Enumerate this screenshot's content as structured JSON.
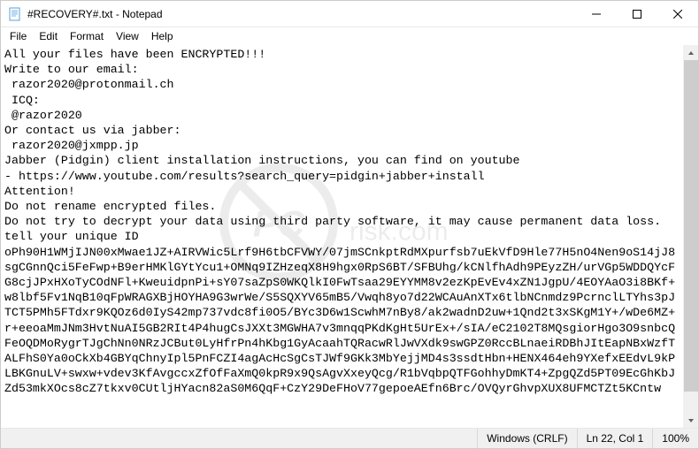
{
  "window": {
    "title": "#RECOVERY#.txt - Notepad"
  },
  "menu": {
    "file": "File",
    "edit": "Edit",
    "format": "Format",
    "view": "View",
    "help": "Help"
  },
  "content": "All your files have been ENCRYPTED!!!\nWrite to our email:\n razor2020@protonmail.ch\n ICQ:\n @razor2020\nOr contact us via jabber:\n razor2020@jxmpp.jp\nJabber (Pidgin) client installation instructions, you can find on youtube\n- https://www.youtube.com/results?search_query=pidgin+jabber+install\nAttention!\nDo not rename encrypted files.\nDo not try to decrypt your data using third party software, it may cause permanent data loss.\ntell your unique ID\noPh90H1WMjIJN00xMwae1JZ+AIRVWic5Lrf9H6tbCFVWY/07jmSCnkptRdMXpurfsb7uEkVfD9Hle77H5nO4Nen9oS14jJ8sgCGnnQci5FeFwp+B9erHMKlGYtYcu1+OMNq9IZHzeqX8H9hgx0RpS6BT/SFBUhg/kCNlfhAdh9PEyzZH/urVGp5WDDQYcFG8cjJPxHXoTyCOdNFl+KweuidpnPi+sY07saZpS0WKQlkI0FwTsaa29EYYMM8v2ezKpEvEv4xZN1JgpU/4EOYAaO3i8BKf+w8lbf5Fv1NqB10qFpWRAGXBjHOYHA9G3wrWe/S5SQXYV65mB5/Vwqh8yo7d22WCAuAnXTx6tlbNCnmdz9PcrnclLTYhs3pJTCT5PMh5FTdxr9KQOz6d0IyS42mp737vdc8fi0O5/BYc3D6w1ScwhM7nBy8/ak2wadnD2uw+1Qnd2t3xSKgM1Y+/wDe6MZ+r+eeoaMmJNm3HvtNuAI5GB2RIt4P4hugCsJXXt3MGWHA7v3mnqqPKdKgHt5UrEx+/sIA/eC2102T8MQsgiorHgo3O9snbcQFeOQDMoRygrTJgChNn0NRzJCBut0LyHfrPn4hKbg1GyAcaahTQRacwRlJwVXdk9swGPZ0RccBLnaeiRDBhJItEapNBxWzfTALFhS0Ya0oCkXb4GBYqChnyIpl5PnFCZI4agAcHcSgCsTJWf9GKk3MbYejjMD4s3ssdtHbn+HENX464eh9YXefxEEdvL9kPLBKGnuLV+swxw+vdev3KfAvgccxZfOfFaXmQ0kpR9x9QsAgvXxeyQcg/R1bVqbpQTFGohhyDmKT4+ZpgQZd5PT09EcGhKbJZd53mkXOcs8cZ7tkxv0CUtljHYacn82aS0M6QqF+CzY29DeFHoV77gepoeAEfn6Brc/OVQyrGhvpXUX8UFMCTZt5KCntw",
  "status": {
    "eol": "Windows (CRLF)",
    "pos": "Ln 22, Col 1",
    "zoom": "100%"
  },
  "watermark_text": "pcrisk.com"
}
